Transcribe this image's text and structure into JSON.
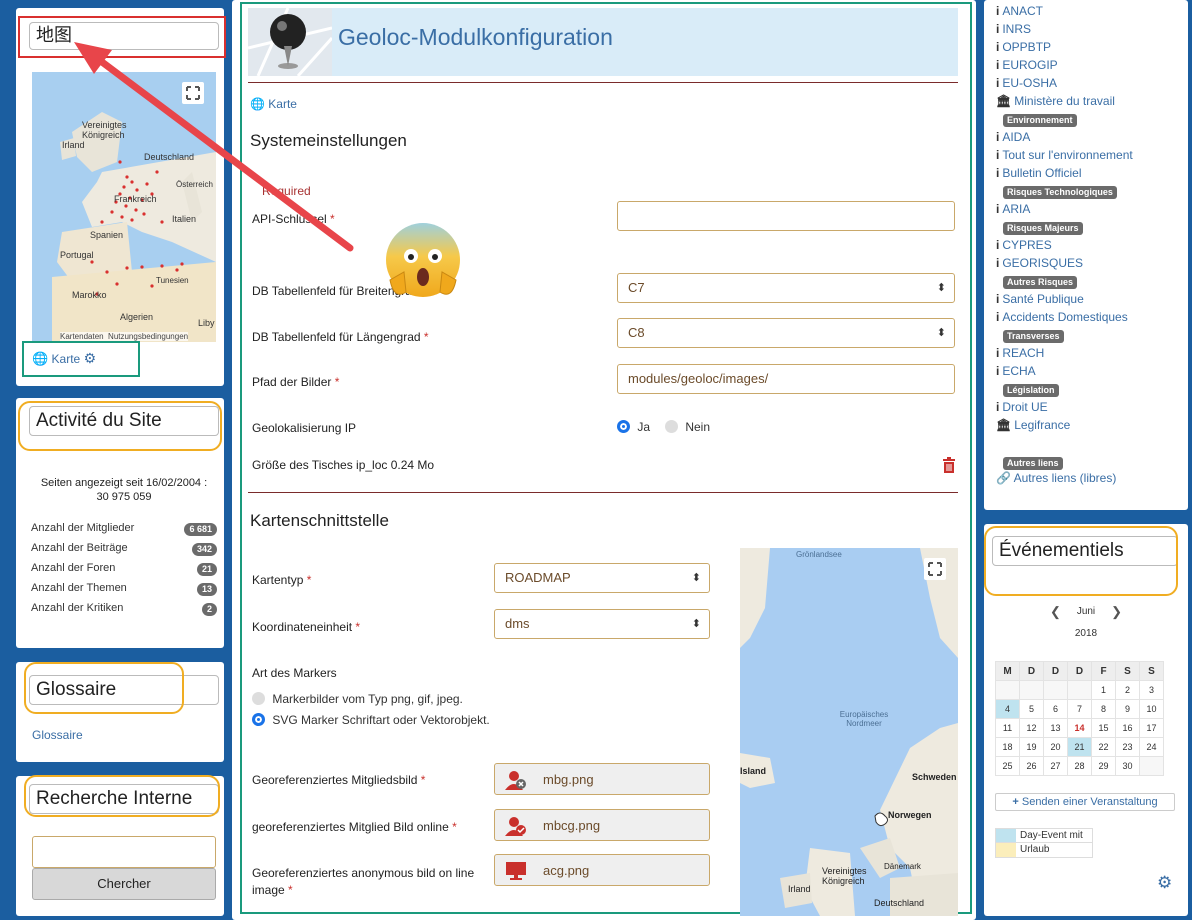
{
  "left": {
    "map_block": {
      "title": "地图",
      "map_labels": [
        "Vereinigtes Königreich",
        "Irland",
        "Deutschland",
        "Frankreich",
        "Österreich",
        "Italien",
        "Spanien",
        "Portugal",
        "Tunesien",
        "Marokko",
        "Algerien",
        "Liby"
      ],
      "map_footer": "Kartendaten  Nutzungsbedingungen",
      "link": "Karte"
    },
    "activity": {
      "title": "Activité du Site",
      "summary": "Seiten angezeigt seit 16/02/2004 : 30 975 059",
      "stats": [
        {
          "label": "Anzahl der Mitglieder",
          "value": "6 681"
        },
        {
          "label": "Anzahl der Beiträge",
          "value": "342"
        },
        {
          "label": "Anzahl der Foren",
          "value": "21"
        },
        {
          "label": "Anzahl der Themen",
          "value": "13"
        },
        {
          "label": "Anzahl der Kritiken",
          "value": "2"
        }
      ]
    },
    "glossary": {
      "title": "Glossaire",
      "link": "Glossaire"
    },
    "search": {
      "title": "Recherche Interne",
      "button": "Chercher",
      "value": ""
    }
  },
  "main": {
    "title": "Geoloc-Modulkonfiguration",
    "breadcrumb": "Karte",
    "section1": "Systemeinstellungen",
    "required_note": "Required",
    "api_label": "API-Schlüssel",
    "api_value": "",
    "lat_label": "DB Tabellenfeld für Breitengrad",
    "lat_value": "C7",
    "lng_label": "DB Tabellenfeld für Längengrad",
    "lng_value": "C8",
    "path_label": "Pfad der Bilder",
    "path_value": "modules/geoloc/images/",
    "ip_label": "Geolokalisierung IP",
    "ip_yes": "Ja",
    "ip_no": "Nein",
    "ip_selected": "Ja",
    "table_size": "Größe des Tisches ip_loc 0.24 Mo",
    "section2": "Kartenschnittstelle",
    "maptype_label": "Kartentyp",
    "maptype_value": "ROADMAP",
    "coord_label": "Koordinateneinheit",
    "coord_value": "dms",
    "marker_label": "Art des Markers",
    "marker_opt1": "Markerbilder vom Typ png, gif, jpeg.",
    "marker_opt2": "SVG Marker Schriftart oder Vektorobjekt.",
    "marker_selected": "SVG Marker Schriftart oder Vektorobjekt.",
    "img1_label": "Georeferenziertes Mitgliedsbild",
    "img1_value": "mbg.png",
    "img2_label": "georeferenziertes Mitglied Bild online",
    "img2_value": "mbcg.png",
    "img3_label": "Georeferenziertes anonymous bild on line image",
    "img3_value": "acg.png",
    "map_labels": [
      "Grönlandsee",
      "Europäisches Nordmeer",
      "Island",
      "Schweden",
      "Norwegen",
      "Dänemark",
      "Vereinigtes Königreich",
      "Irland",
      "Deutschland"
    ]
  },
  "right": {
    "links": [
      {
        "type": "info",
        "text": "ANACT"
      },
      {
        "type": "info",
        "text": "INRS"
      },
      {
        "type": "info",
        "text": "OPPBTP"
      },
      {
        "type": "info",
        "text": "EUROGIP"
      },
      {
        "type": "info",
        "text": "EU-OSHA"
      },
      {
        "type": "bank",
        "text": "Ministère du travail"
      },
      {
        "type": "tag",
        "text": "Environnement"
      },
      {
        "type": "info",
        "text": "AIDA"
      },
      {
        "type": "info",
        "text": "Tout sur l'environnement"
      },
      {
        "type": "info",
        "text": "Bulletin Officiel"
      },
      {
        "type": "tag",
        "text": "Risques Technologiques"
      },
      {
        "type": "info",
        "text": "ARIA"
      },
      {
        "type": "tag",
        "text": "Risques Majeurs"
      },
      {
        "type": "info",
        "text": "CYPRES"
      },
      {
        "type": "info",
        "text": "GEORISQUES"
      },
      {
        "type": "tag",
        "text": "Autres Risques"
      },
      {
        "type": "info",
        "text": "Santé Publique"
      },
      {
        "type": "info",
        "text": "Accidents Domestiques"
      },
      {
        "type": "tag",
        "text": "Transverses"
      },
      {
        "type": "info",
        "text": "REACH"
      },
      {
        "type": "info",
        "text": "ECHA"
      },
      {
        "type": "tag",
        "text": "Législation"
      },
      {
        "type": "info",
        "text": "Droit UE"
      },
      {
        "type": "bank",
        "text": "Legifrance"
      }
    ],
    "other_tag": "Autres liens",
    "other_link": "Autres liens (libres)",
    "events": {
      "title": "Événementiels",
      "month": "Juni",
      "year": "2018",
      "weekdays": [
        "M",
        "D",
        "D",
        "D",
        "F",
        "S",
        "S"
      ],
      "weeks": [
        [
          "",
          "",
          "",
          "",
          "1",
          "2",
          "3"
        ],
        [
          "4",
          "5",
          "6",
          "7",
          "8",
          "9",
          "10"
        ],
        [
          "11",
          "12",
          "13",
          "14",
          "15",
          "16",
          "17"
        ],
        [
          "18",
          "19",
          "20",
          "21",
          "22",
          "23",
          "24"
        ],
        [
          "25",
          "26",
          "27",
          "28",
          "29",
          "30",
          ""
        ]
      ],
      "today": "14",
      "highlighted": [
        "4",
        "21"
      ],
      "add_button": "Senden einer Veranstaltung",
      "legend1": "Day-Event mit",
      "legend2": "Urlaub"
    }
  },
  "colors": {
    "accent": "#3a6ea5",
    "page_bg": "#1b5ea0",
    "title_bg": "#d9ecf8",
    "orange": "#f0ad22",
    "teal": "#1a9a7d",
    "red": "#d9302f"
  }
}
